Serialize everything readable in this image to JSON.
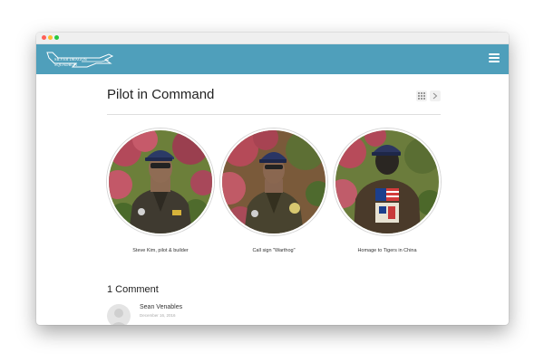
{
  "header": {
    "brand_name": "SILVER DRAGON SQUADRON",
    "colors": {
      "header_bg": "#4f9fbb",
      "close": "#ff5f57",
      "minimize": "#febc2e",
      "maximize": "#28c840"
    }
  },
  "page": {
    "title": "Pilot in Command",
    "nav_icons": [
      "grid-icon",
      "chevron-right-icon"
    ]
  },
  "gallery": [
    {
      "caption": "Steve Kim, pilot & builder"
    },
    {
      "caption": "Call sign \"Warthog\""
    },
    {
      "caption": "Homage to Tigers in China"
    }
  ],
  "comments": {
    "heading": "1 Comment",
    "items": [
      {
        "author": "Sean Venables",
        "date": "December 16, 2016"
      }
    ]
  }
}
